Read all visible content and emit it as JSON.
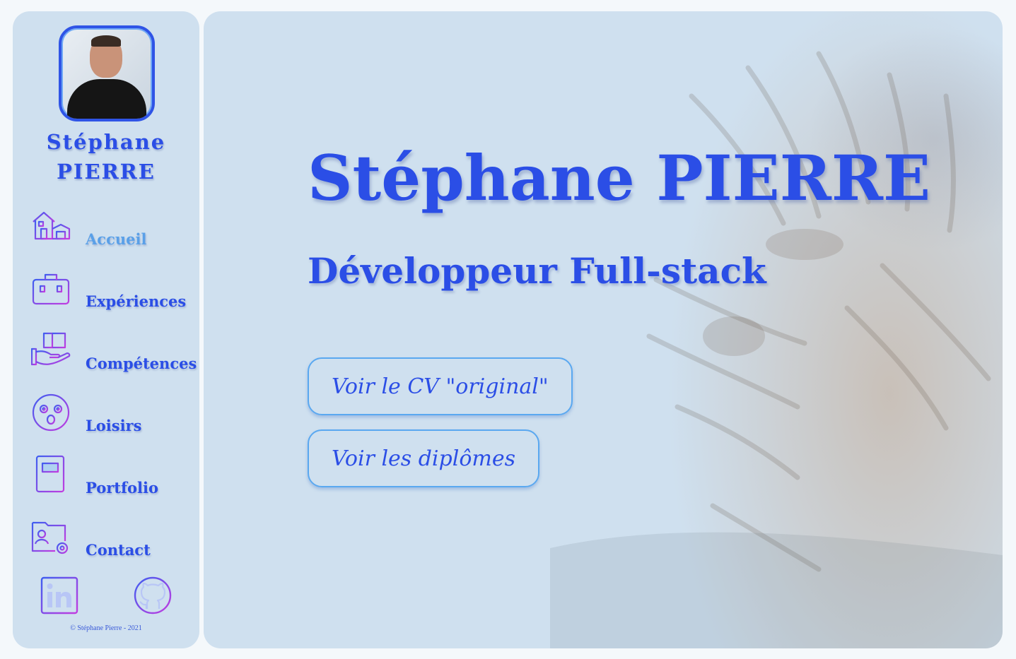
{
  "sidebar": {
    "first_name": "Stéphane",
    "last_name": "PIERRE",
    "nav": [
      {
        "label": "Accueil",
        "icon": "house-icon",
        "active": true
      },
      {
        "label": "Expériences",
        "icon": "briefcase-icon",
        "active": false
      },
      {
        "label": "Compétences",
        "icon": "book-hand-icon",
        "active": false
      },
      {
        "label": "Loisirs",
        "icon": "smiley-face-icon",
        "active": false
      },
      {
        "label": "Portfolio",
        "icon": "notebook-icon",
        "active": false
      },
      {
        "label": "Contact",
        "icon": "contact-card-icon",
        "active": false
      }
    ],
    "social": [
      {
        "label": "in",
        "icon": "linkedin-icon"
      },
      {
        "label": "github",
        "icon": "github-icon"
      }
    ],
    "copyright": "© Stéphane Pierre - 2021"
  },
  "hero": {
    "title": "Stéphane PIERRE",
    "subtitle": "Développeur Full-stack",
    "buttons": [
      {
        "label": "Voir le CV \"original\""
      },
      {
        "label": "Voir les diplômes"
      }
    ]
  },
  "colors": {
    "accent": "#2b4ee6",
    "active": "#5aa0e8",
    "panel": "#cfe0ef",
    "icon_gradient_start": "#3f5ef0",
    "icon_gradient_end": "#c23ce0"
  }
}
